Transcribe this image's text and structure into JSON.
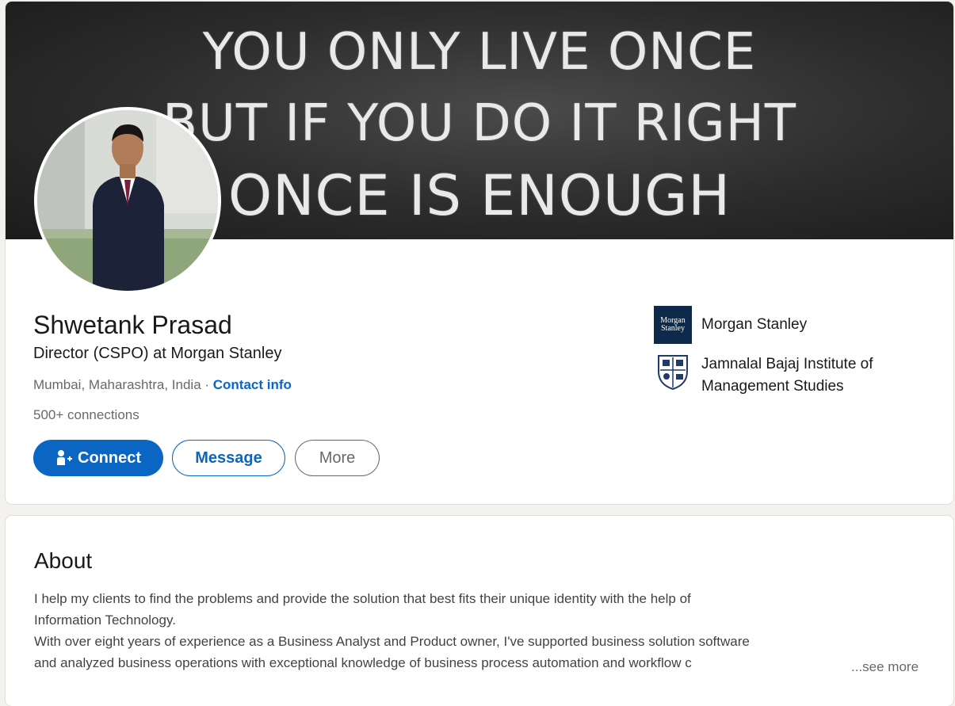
{
  "banner": {
    "lines": [
      "YOU ONLY LIVE ONCE",
      "BUT IF YOU DO IT RIGHT",
      "ONCE IS ENOUGH"
    ]
  },
  "profile": {
    "name": "Shwetank Prasad",
    "headline": "Director (CSPO) at Morgan Stanley",
    "location": "Mumbai, Maharashtra, India",
    "separator": " · ",
    "contact_label": "Contact info",
    "connections": "500+ connections"
  },
  "actions": {
    "connect_label": "Connect",
    "message_label": "Message",
    "more_label": "More"
  },
  "experience": {
    "company": "Morgan Stanley",
    "logo_text_1": "Morgan",
    "logo_text_2": "Stanley"
  },
  "education": {
    "school": "Jamnalal Bajaj Institute of Management Studies"
  },
  "about": {
    "title": "About",
    "lines": [
      "I help my clients to find the problems and provide the solution that best fits their unique identity with the help of",
      "Information Technology.",
      "With over eight years of experience as a Business Analyst and Product owner, I've supported business solution software",
      "and analyzed business operations with exceptional knowledge of business process automation and workflow c"
    ],
    "see_more": "...see more"
  },
  "colors": {
    "accent": "#0a66c2",
    "page_bg": "#f3f2ef"
  },
  "icons": {
    "connect": "person-add-icon"
  }
}
